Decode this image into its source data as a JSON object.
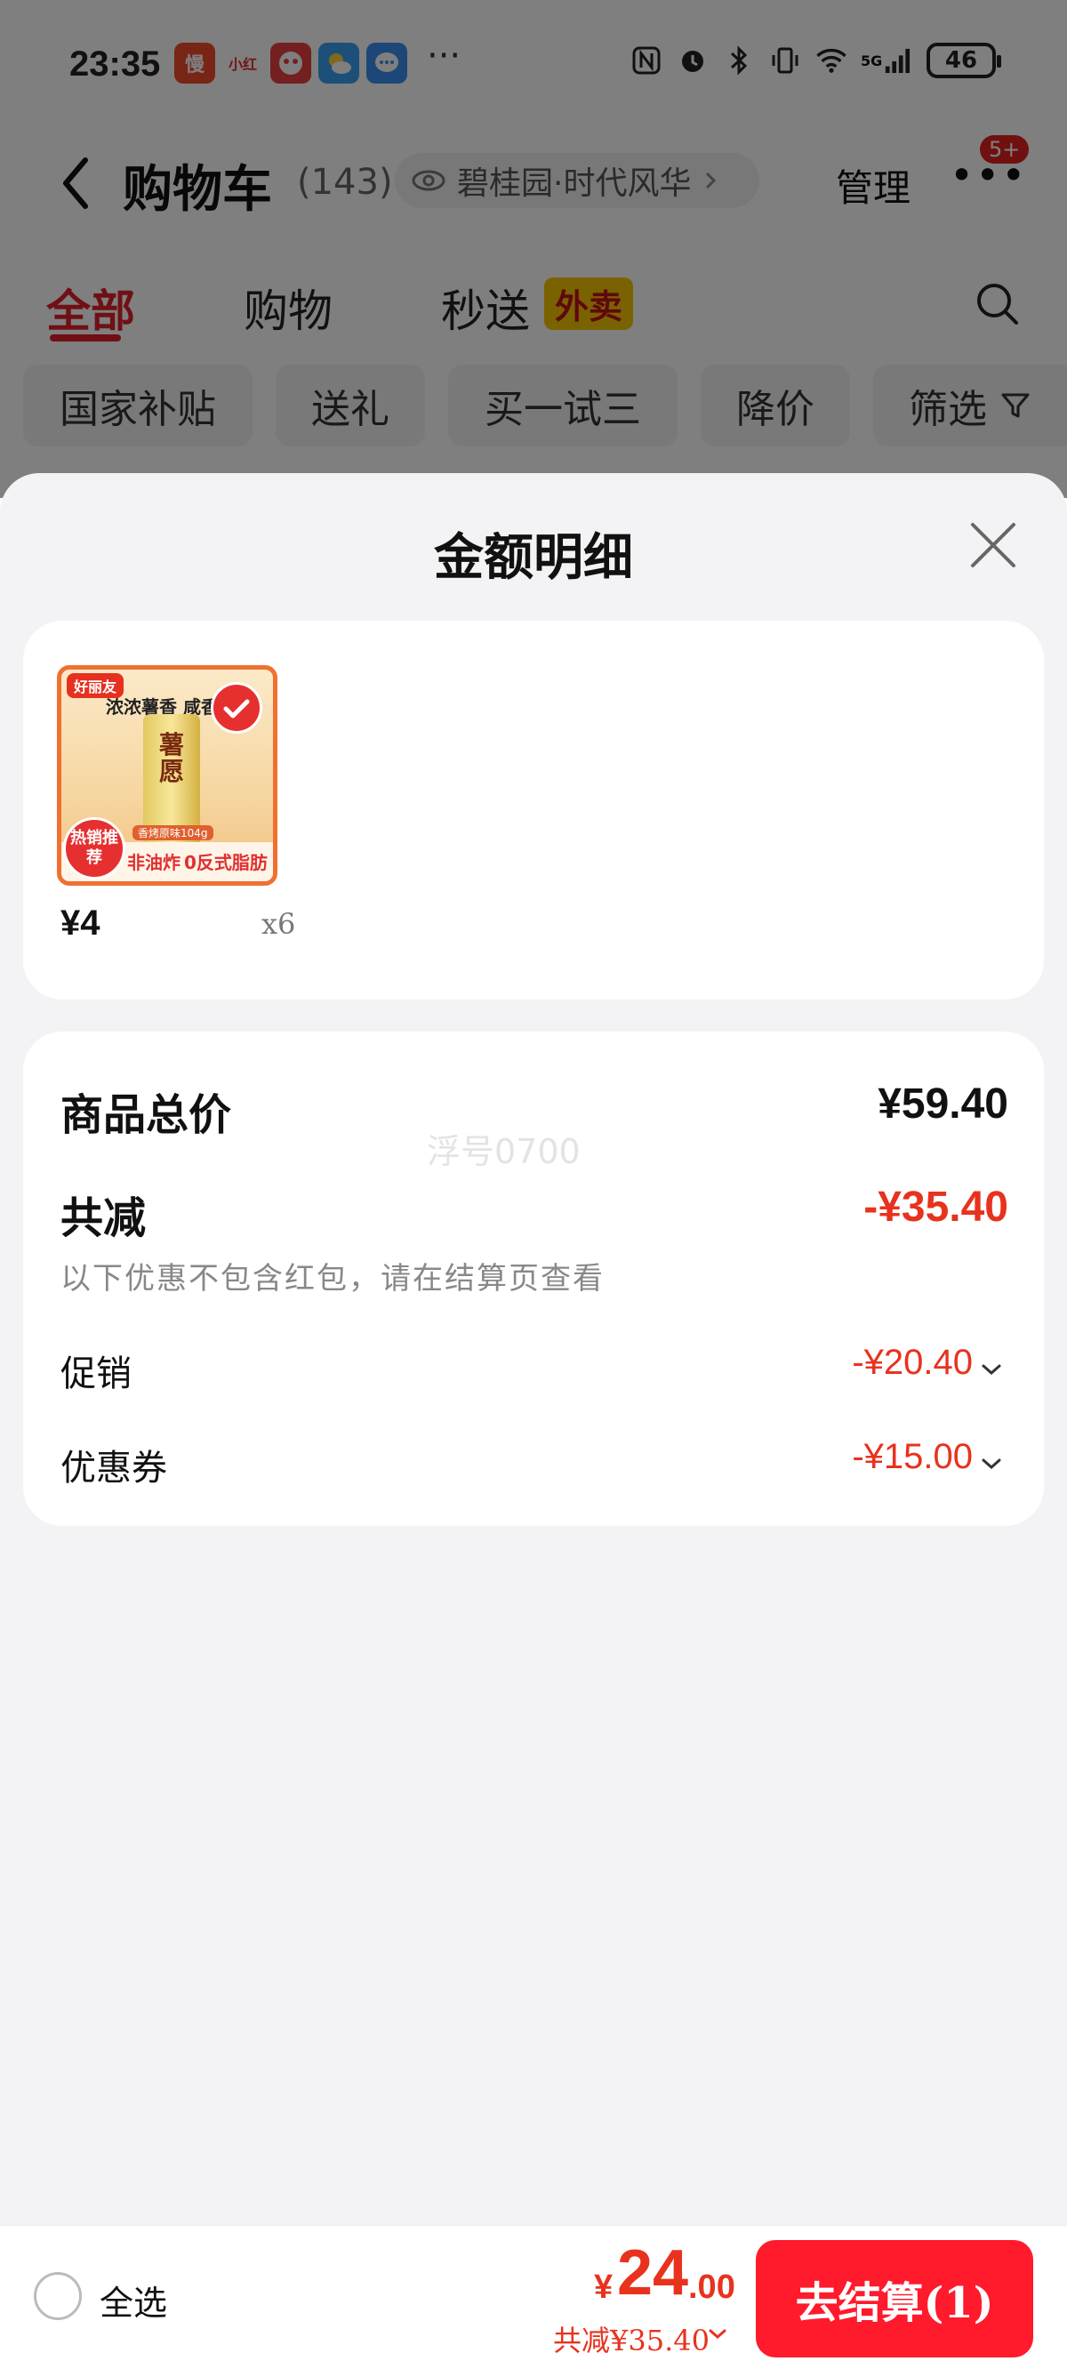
{
  "status_bar": {
    "time": "23:35",
    "app_icons": [
      {
        "name": "slow-app-icon",
        "label": "慢",
        "color": "#f04a2a"
      },
      {
        "name": "xiaohongshu-icon",
        "label": "小红",
        "color": "#ffffff"
      },
      {
        "name": "game-app-icon",
        "label": "",
        "color": "#e84040"
      },
      {
        "name": "weather-app-icon",
        "label": "",
        "color": "#3aa0f0"
      },
      {
        "name": "message-app-icon",
        "label": "",
        "color": "#3a8ef0"
      }
    ],
    "more": "···",
    "signal_label": "5G",
    "battery": "46"
  },
  "navbar": {
    "title": "购物车",
    "count": "(143)",
    "address": "碧桂园·时代风华",
    "manage": "管理",
    "badge": "5+"
  },
  "tabs": [
    {
      "label": "全部",
      "active": true
    },
    {
      "label": "购物",
      "active": false
    },
    {
      "label": "秒送",
      "active": false
    }
  ],
  "tab_tag": "外卖",
  "filters": [
    "国家补贴",
    "送礼",
    "买一试三",
    "降价",
    "筛选"
  ],
  "sheet": {
    "title": "金额明细",
    "product": {
      "brand": "好丽友",
      "slogan": "浓浓薯香 咸香滋",
      "can_label": "薯愿",
      "flavor": "香烤原味104g",
      "hot_tag": "热销推荐",
      "feature1": "非油炸",
      "feature2": "0反式脂肪",
      "price": "¥4",
      "qty": "x6"
    },
    "summary": {
      "total_label": "商品总价",
      "total_value": "¥59.40",
      "reduce_label": "共减",
      "reduce_value": "-¥35.40",
      "note": "以下优惠不包含红包，请在结算页查看",
      "promo_label": "促销",
      "promo_value": "-¥20.40",
      "coupon_label": "优惠券",
      "coupon_value": "-¥15.00",
      "watermark": "浮号0700"
    }
  },
  "bottom_bar": {
    "select_all": "全选",
    "currency": "¥",
    "price_int": "24",
    "price_dec": ".00",
    "reduce_line": "共减¥35.40",
    "checkout": "去结算(1)"
  },
  "colors": {
    "accent_red": "#e8321e",
    "button_red": "#ff1a2c",
    "tag_yellow": "#f5c400"
  }
}
